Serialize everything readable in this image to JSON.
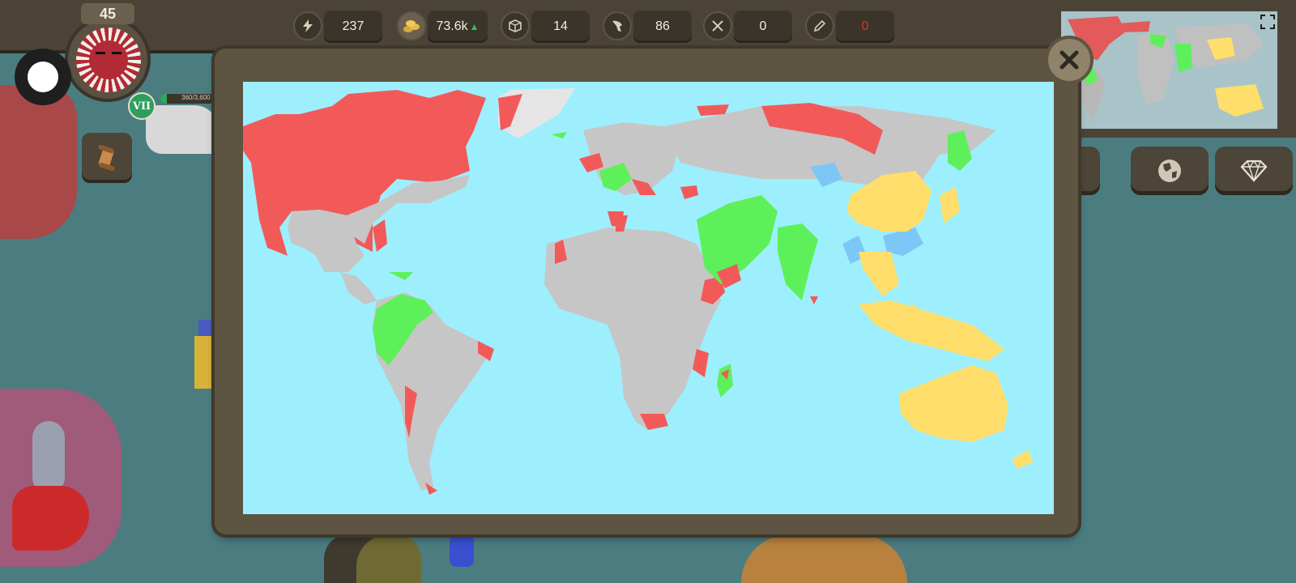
{
  "colors": {
    "ocean": "#9deffe",
    "neutral_land": "#c6c6c6",
    "own_nation": "#f25a5a",
    "ally": "#5ef05a",
    "faction_blue": "#7cc7f5",
    "faction_yellow": "#ffde6b",
    "unexplored": "#e5e5e5"
  },
  "player": {
    "level": "45",
    "rank": "VII",
    "xp_text": "360/3,600",
    "xp_fraction": 0.1,
    "flag": "red-sun-flag-icon"
  },
  "resources": [
    {
      "icon": "lightning-icon",
      "value": "237"
    },
    {
      "icon": "gold-coins-icon",
      "value": "73.6k",
      "trend": "up-arrow-icon"
    },
    {
      "icon": "crate-icon",
      "value": "14"
    },
    {
      "icon": "fist-icon",
      "value": "86"
    },
    {
      "icon": "combat-icon",
      "value": "0"
    },
    {
      "icon": "pencil-icon",
      "value": "0",
      "alert_color": "#d63a2a"
    }
  ],
  "side_buttons": [
    {
      "icon": "pencil-icon"
    },
    {
      "icon": "globe-icon"
    },
    {
      "icon": "diamond-icon"
    }
  ],
  "popup": {
    "close_icon": "close-x-icon"
  },
  "minimap": {
    "expand_icon": "fullscreen-icon"
  }
}
